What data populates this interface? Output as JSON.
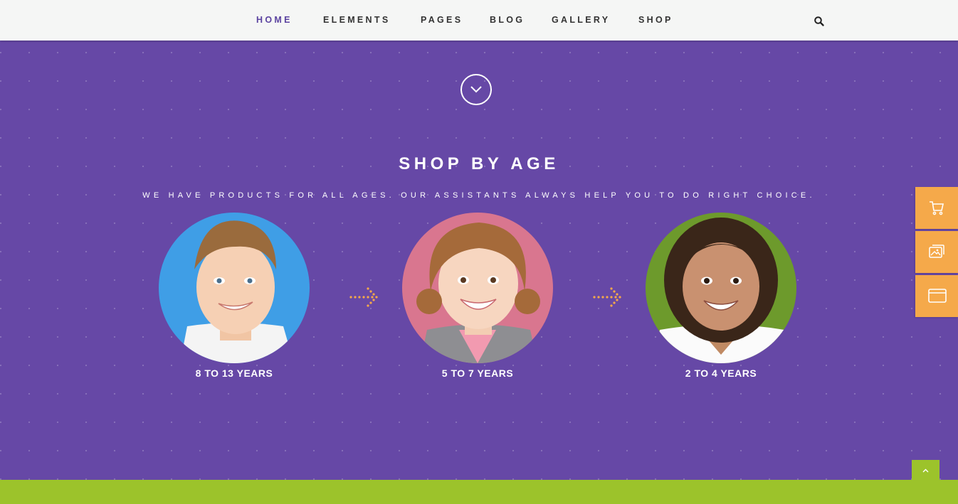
{
  "nav": {
    "items": [
      {
        "label": "HOME",
        "active": true
      },
      {
        "label": "ELEMENTS",
        "active": false
      },
      {
        "label": "PAGES",
        "active": false
      },
      {
        "label": "BLOG",
        "active": false
      },
      {
        "label": "GALLERY",
        "active": false
      },
      {
        "label": "SHOP",
        "active": false
      }
    ],
    "search_icon": "search-icon"
  },
  "section": {
    "scroll_icon": "chevron-down-icon",
    "title": "SHOP BY AGE",
    "subtitle": "WE HAVE PRODUCTS FOR ALL AGES. OUR ASSISTANTS ALWAYS HELP YOU TO DO RIGHT CHOICE.",
    "ages": [
      {
        "label": "8 TO 13 YEARS"
      },
      {
        "label": "5 TO 7 YEARS"
      },
      {
        "label": "2 TO 4 YEARS"
      }
    ]
  },
  "side_tabs": [
    {
      "icon": "cart-icon"
    },
    {
      "icon": "gallery-icon"
    },
    {
      "icon": "browser-window-icon"
    }
  ],
  "back_to_top_icon": "chevron-up-icon",
  "colors": {
    "purple": "#6648a6",
    "orange": "#f5a94a",
    "green": "#9cc32b",
    "nav_active": "#5b43a0"
  }
}
